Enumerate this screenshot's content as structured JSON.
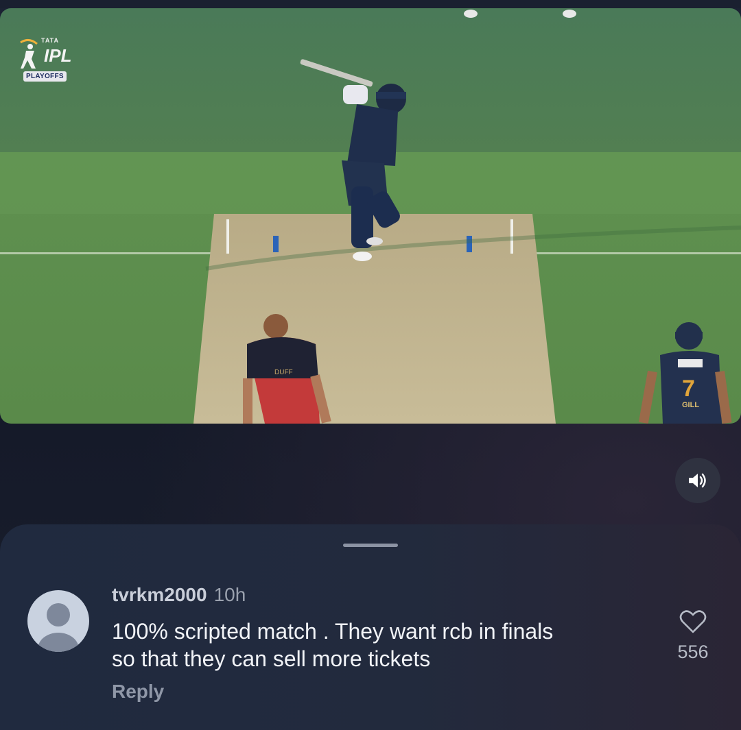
{
  "video": {
    "logo": {
      "brand": "TATA",
      "title": "IPL",
      "subtitle": "PLAYOFFS"
    },
    "jerseys": {
      "bowler_name": "DUFF",
      "fielder_number": "7",
      "fielder_name": "GILL"
    }
  },
  "controls": {
    "sound_icon": "speaker-on-icon"
  },
  "comment": {
    "username": "tvrkm2000",
    "time": "10h",
    "text_line1": "100% scripted match . They want rcb in finals",
    "text_line2": "so that they can sell more tickets",
    "reply_label": "Reply",
    "like_count": "556"
  }
}
